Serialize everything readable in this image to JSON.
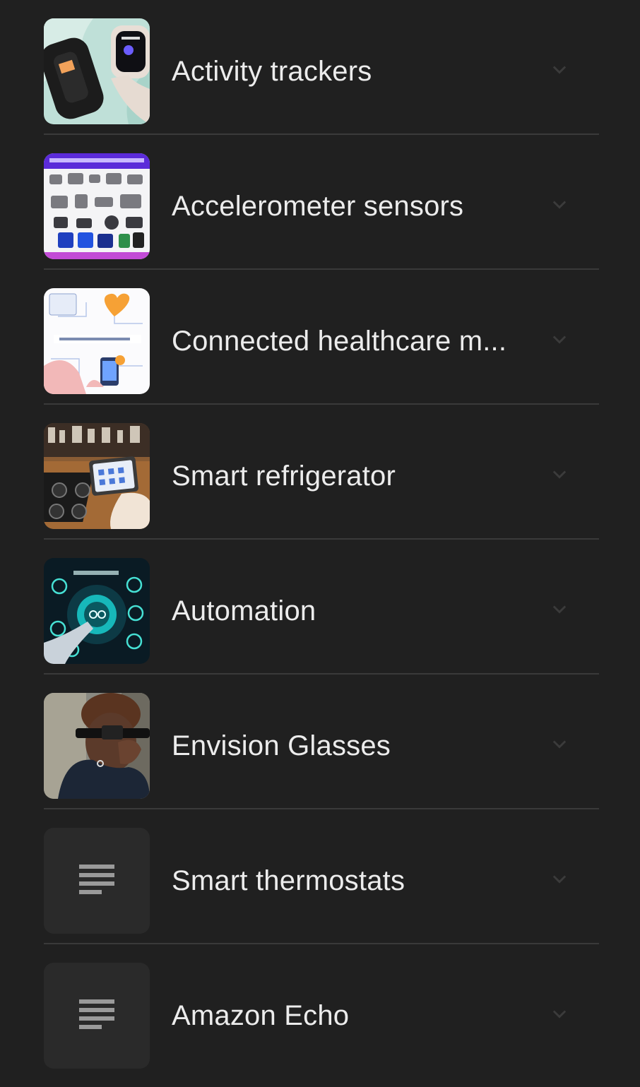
{
  "results": {
    "items": [
      {
        "label": "Activity trackers",
        "thumbnail": "fitness-band-and-smartwatch-image"
      },
      {
        "label": "Accelerometer sensors",
        "thumbnail": "sensor-modules-collage-image"
      },
      {
        "label": "Connected healthcare m...",
        "thumbnail": "health-monitoring-illustration-image"
      },
      {
        "label": "Smart refrigerator",
        "thumbnail": "kitchen-tablet-image"
      },
      {
        "label": "Automation",
        "thumbnail": "automation-gears-image"
      },
      {
        "label": "Envision Glasses",
        "thumbnail": "person-wearing-smart-glasses-image"
      },
      {
        "label": "Smart thermostats",
        "thumbnail": "document-lines-icon"
      },
      {
        "label": "Amazon Echo",
        "thumbnail": "document-lines-icon"
      }
    ]
  },
  "colors": {
    "background": "#202020",
    "divider": "#3a3a3a",
    "text": "#ececec",
    "placeholder_tile": "#2a2a2a",
    "placeholder_icon": "#9a9a9a"
  },
  "icons": {
    "expand": "chevron-down-icon",
    "placeholder": "document-lines-icon"
  }
}
